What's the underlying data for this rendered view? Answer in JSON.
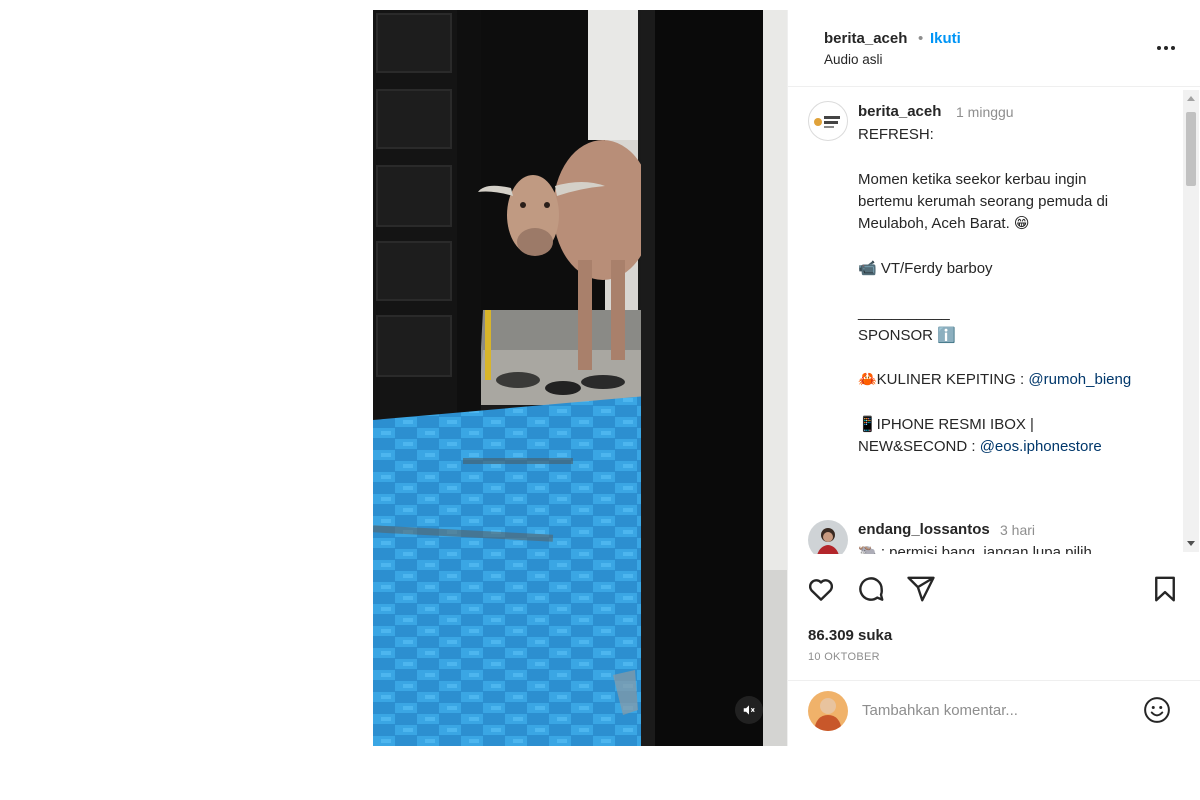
{
  "post": {
    "author": "berita_aceh",
    "follow_separator": "•",
    "follow_label": "Ikuti",
    "audio_label": "Audio asli",
    "more_icon": "more-horizontal-icon"
  },
  "caption": {
    "username": "berita_aceh",
    "timestamp": "1 minggu",
    "lines": [
      "REFRESH:",
      "",
      "Momen ketika seekor kerbau ingin",
      "bertemu kerumah seorang pemuda di",
      "Meulaboh, Aceh Barat. 😁",
      "",
      "📹 VT/Ferdy barboy",
      "",
      "___________",
      "SPONSOR ℹ️",
      "",
      "🦀KULINER KEPITING : ",
      "",
      "📱IPHONE RESMI IBOX |",
      "NEW&SECOND : "
    ],
    "mention_1": "@rumoh_bieng",
    "mention_2": "@eos.iphonestore"
  },
  "comment": {
    "username": "endang_lossantos",
    "timestamp": "3 hari",
    "text": "🐃 : permisi bang, jangan lupa pilih"
  },
  "stats": {
    "likes": "86.309 suka",
    "date": "10 OKTOBER"
  },
  "add_comment": {
    "placeholder": "Tambahkan komentar..."
  },
  "icons": [
    "heart-icon",
    "comment-icon",
    "share-icon",
    "bookmark-icon",
    "emoji-icon",
    "mute-icon"
  ],
  "colors": {
    "accent": "#0095f6",
    "text": "#262626",
    "muted": "#8e8e8e",
    "link": "#00376b",
    "floor": "#2f9ad6"
  }
}
